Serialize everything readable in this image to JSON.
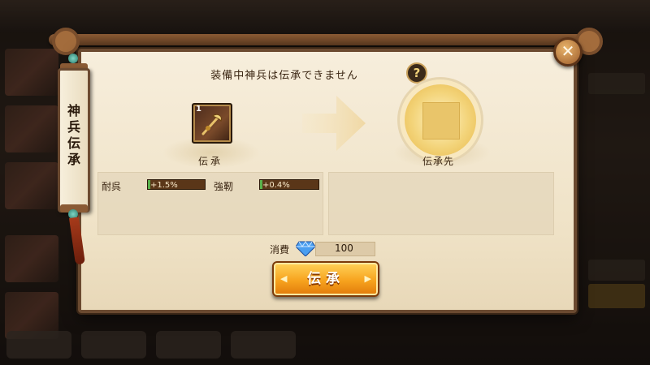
{
  "dialog": {
    "side_tab_label": "神兵伝承",
    "notice": "装備中神兵は伝承できません",
    "help_glyph": "?",
    "close_glyph": "✕"
  },
  "source": {
    "level": "1",
    "label": "伝承"
  },
  "target": {
    "label": "伝承先"
  },
  "stats": [
    {
      "name": "耐呉",
      "value": "+1.5%"
    },
    {
      "name": "強靭",
      "value": "+0.4%"
    }
  ],
  "cost": {
    "label": "消費",
    "value": "100",
    "currency_icon": "diamond-gem-icon"
  },
  "confirm_button": {
    "label": "伝承"
  },
  "colors": {
    "panel": "#f7eedc",
    "border": "#6b4a30",
    "button": "#f7a31e",
    "stat_bar": "#5a3618"
  }
}
